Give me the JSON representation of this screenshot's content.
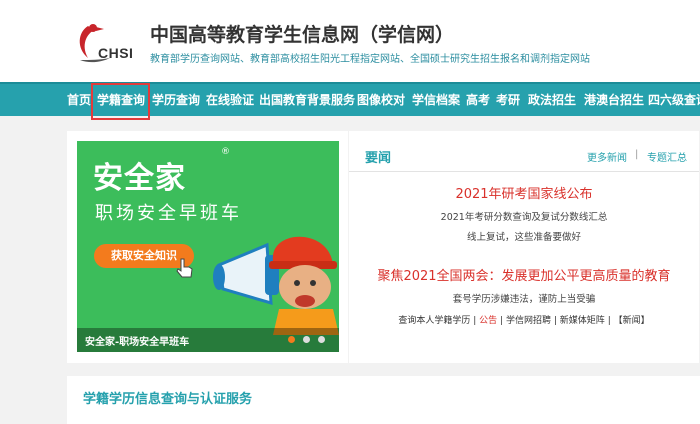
{
  "header": {
    "logo_text": "CHSI",
    "title": "中国高等教育学生信息网（学信网）",
    "subtitle": "教育部学历查询网站、教育部高校招生阳光工程指定网站、全国硕士研究生招生报名和调剂指定网站"
  },
  "nav": {
    "items": [
      {
        "label": "首页"
      },
      {
        "label": "学籍查询",
        "highlighted": true
      },
      {
        "label": "学历查询"
      },
      {
        "label": "在线验证"
      },
      {
        "label": "出国教育背景服务"
      },
      {
        "label": "图像校对"
      },
      {
        "label": "学信档案"
      },
      {
        "label": "高考"
      },
      {
        "label": "考研"
      },
      {
        "label": "政法招生"
      },
      {
        "label": "港澳台招生"
      },
      {
        "label": "四六级查询"
      }
    ],
    "highlight_color": "#e23b3b",
    "bar_color": "#26a1ad"
  },
  "banner": {
    "title": "安全家",
    "registered_mark": "®",
    "subtitle": "职场安全早班车",
    "button": "获取安全知识",
    "caption": "安全家-职场安全早班车",
    "slide_count": 3,
    "active_slide": 1
  },
  "news": {
    "heading": "要闻",
    "more_label": "更多新闻",
    "topics_label": "专题汇总",
    "divider": "|",
    "headline1": "2021年研考国家线公布",
    "line1": "2021年考研分数查询及复试分数线汇总",
    "line2": "线上复试，这些准备要做好",
    "headline2": "聚焦2021全国两会：发展更加公平更高质量的教育",
    "line3": "套号学历涉嫌违法，谨防上当受骗",
    "quick_links": {
      "a": "查询本人学籍学历",
      "b": "公告",
      "c": "学信网招聘",
      "d": "新媒体矩阵",
      "e": "【新闻】",
      "sep": "|"
    }
  },
  "services": {
    "heading": "学籍学历信息查询与认证服务"
  }
}
